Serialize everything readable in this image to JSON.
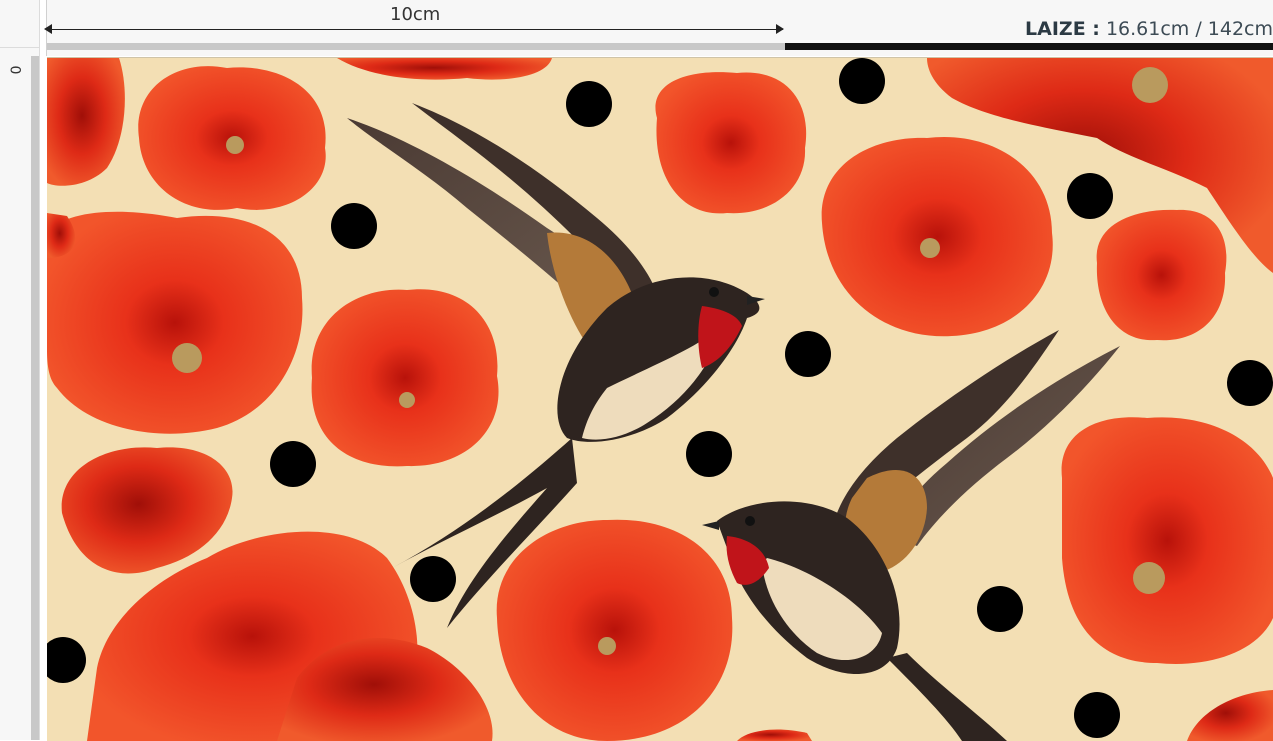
{
  "ruler": {
    "measure_label": "10cm",
    "vertical_origin": "0"
  },
  "laize": {
    "label": "LAIZE :",
    "value": "16.61cm / 142cm"
  },
  "pattern": {
    "motifs": [
      "red poppies",
      "barn swallows",
      "black polka dots"
    ],
    "background_color": "#f3dfb4",
    "poppy_color": "#e8311a",
    "dot_color": "#000000"
  }
}
